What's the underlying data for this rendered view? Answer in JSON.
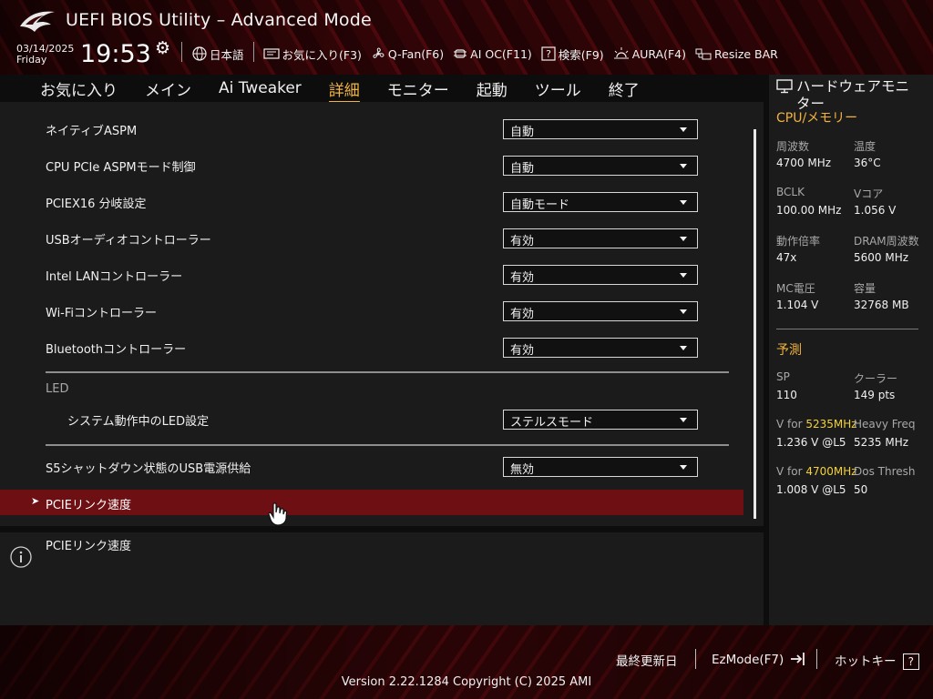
{
  "header": {
    "title": "UEFI BIOS Utility – Advanced Mode",
    "date": "03/14/2025",
    "day": "Friday",
    "time": "19:53",
    "toolbar": [
      {
        "label": "日本語",
        "icon": "globe-icon"
      },
      {
        "label": "お気に入り(F3)",
        "icon": "favorites-icon"
      },
      {
        "label": "Q-Fan(F6)",
        "icon": "fan-icon"
      },
      {
        "label": "AI OC(F11)",
        "icon": "ai-chip-icon"
      },
      {
        "label": "検索(F9)",
        "icon": "search-help-icon"
      },
      {
        "label": "AURA(F4)",
        "icon": "aura-light-icon"
      },
      {
        "label": "Resize BAR",
        "icon": "resize-bar-icon"
      }
    ]
  },
  "tabs": [
    {
      "label": "お気に入り",
      "active": false
    },
    {
      "label": "メイン",
      "active": false
    },
    {
      "label": "Ai Tweaker",
      "active": false
    },
    {
      "label": "詳細",
      "active": true
    },
    {
      "label": "モニター",
      "active": false
    },
    {
      "label": "起動",
      "active": false
    },
    {
      "label": "ツール",
      "active": false
    },
    {
      "label": "終了",
      "active": false
    }
  ],
  "settings": [
    {
      "label": "ネイティブASPM",
      "value": "自動"
    },
    {
      "label": "CPU PCIe ASPMモード制御",
      "value": "自動"
    },
    {
      "label": "PCIEX16 分岐設定",
      "value": "自動モード"
    },
    {
      "label": "USBオーディオコントローラー",
      "value": "有効"
    },
    {
      "label": "Intel LANコントローラー",
      "value": "有効"
    },
    {
      "label": "Wi-Fiコントローラー",
      "value": "有効"
    },
    {
      "label": "Bluetoothコントローラー",
      "value": "有効"
    }
  ],
  "led_section": {
    "heading": "LED",
    "label": "システム動作中のLED設定",
    "value": "ステルスモード"
  },
  "usb_power": {
    "label": "S5シャットダウン状態のUSB電源供給",
    "value": "無効"
  },
  "submenu": {
    "label": "PCIEリンク速度"
  },
  "help": {
    "text": "PCIEリンク速度"
  },
  "hw_monitor": {
    "title": "ハードウェアモニター",
    "cpu_section": "CPU/メモリー",
    "cpu_items": [
      {
        "key": "周波数",
        "value": "4700 MHz"
      },
      {
        "key": "温度",
        "value": "36°C"
      },
      {
        "key": "BCLK",
        "value": "100.00 MHz"
      },
      {
        "key": "Vコア",
        "value": "1.056 V"
      },
      {
        "key": "動作倍率",
        "value": "47x"
      },
      {
        "key": "DRAM周波数",
        "value": "5600 MHz"
      },
      {
        "key": "MC電圧",
        "value": "1.104 V"
      },
      {
        "key": "容量",
        "value": "32768 MB"
      }
    ],
    "predict_section": "予測",
    "predict_items": [
      {
        "key": "SP",
        "value": "110"
      },
      {
        "key": "クーラー",
        "value": "149 pts"
      }
    ],
    "v_for_prefix": "V for",
    "v1_freq": "5235MHz",
    "v1_value": "1.236 V @L5",
    "heavy_freq_label": "Heavy Freq",
    "heavy_freq_value": "5235 MHz",
    "v2_freq": "4700MHz",
    "v2_value": "1.008 V @L5",
    "dos_label": "Dos Thresh",
    "dos_value": "50"
  },
  "footer": {
    "last_modified": "最終更新日",
    "ezmode": "EzMode(F7)",
    "hotkeys": "ホットキー",
    "hotkey_badge": "?",
    "version": "Version 2.22.1284 Copyright (C) 2025 AMI"
  }
}
